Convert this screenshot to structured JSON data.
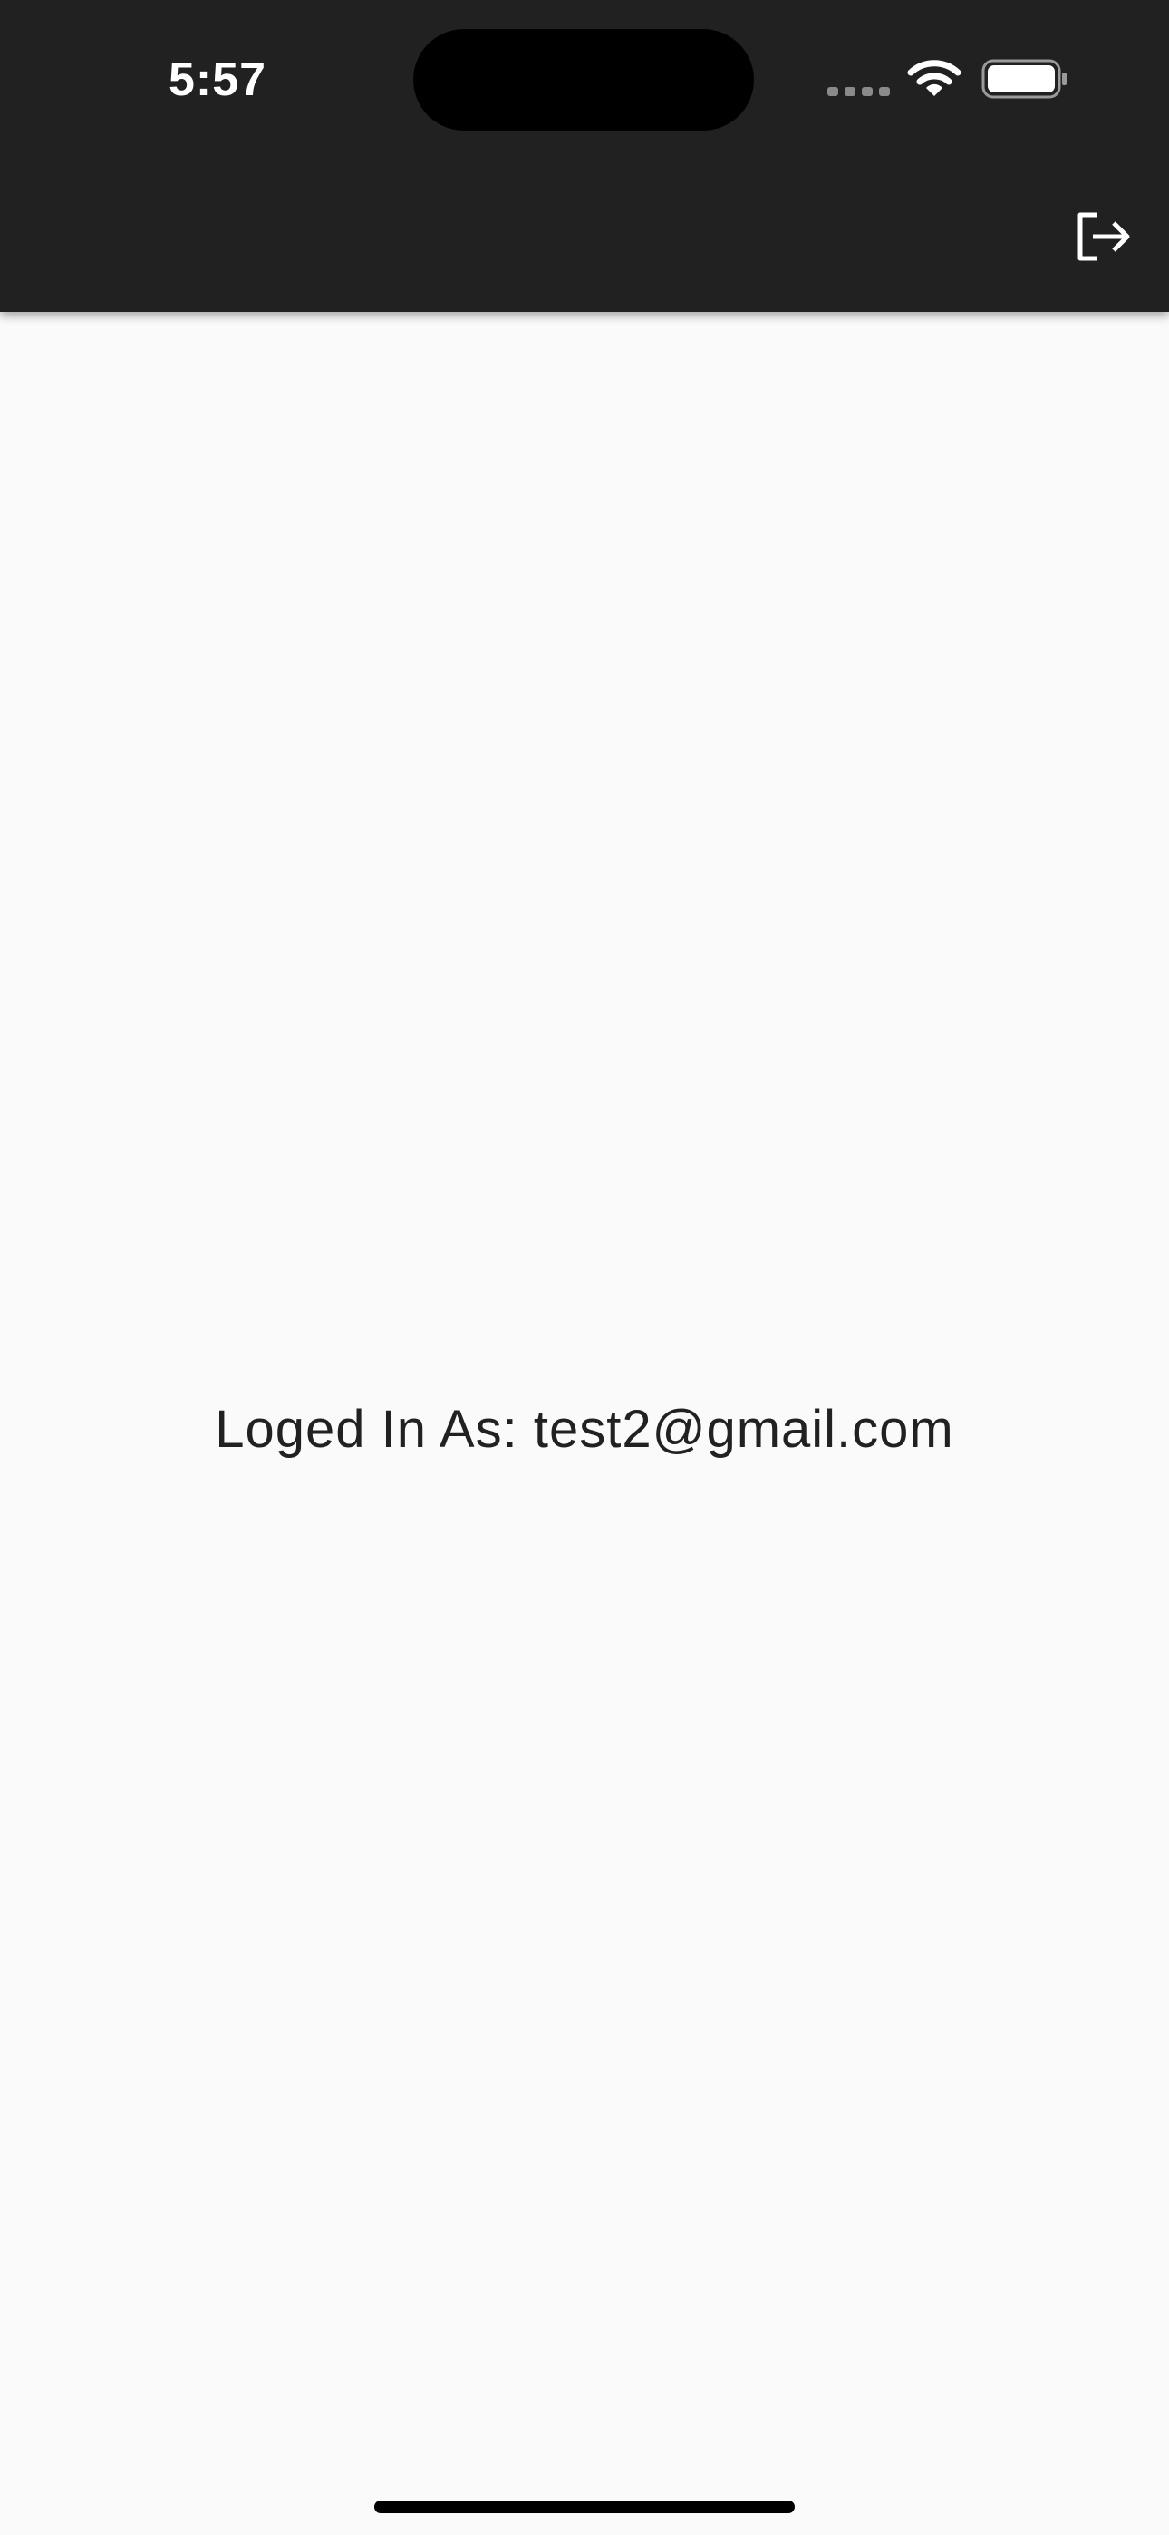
{
  "status_bar": {
    "time": "5:57",
    "icons": [
      "signal-icon",
      "wifi-icon",
      "battery-icon"
    ]
  },
  "app_bar": {
    "background_color": "#212121",
    "actions": [
      {
        "icon": "logout-icon"
      }
    ]
  },
  "main": {
    "logged_in_text": "Loged In As: test2@gmail.com"
  },
  "colors": {
    "page_background": "#fafafa",
    "text": "#212121",
    "app_bar": "#212121"
  }
}
